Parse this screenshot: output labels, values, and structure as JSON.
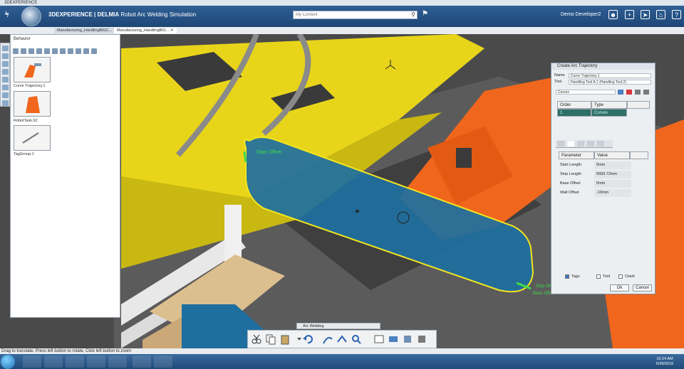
{
  "window": {
    "title": "3DEXPERIENCE"
  },
  "header": {
    "brand": "3DEXPERIENCE | DELMIA",
    "app_name": "Robot Arc Welding Simulation",
    "search_placeholder": "My Content",
    "user": "Demo Developer2"
  },
  "tabs": [
    {
      "label": "Manufacturing_HandlingBiGC..."
    },
    {
      "label": "Manufacturing_HandlingBiG..."
    }
  ],
  "behavior_panel": {
    "title": "Behavior",
    "items": [
      {
        "label": "Curve Trajectory.1"
      },
      {
        "label": "RobotTask.92"
      },
      {
        "label": "TagGroup.1"
      }
    ]
  },
  "dialog": {
    "title": "Create Arc Trajectory",
    "name_label": "Name",
    "name_value": "Curve Trajectory.1",
    "tool_label": "Tool",
    "tool_value": "Handling Tool A.1 (Handling Tool.2)",
    "mode_select": "Curves",
    "grid_headers": [
      "Order",
      "Type"
    ],
    "grid_row": [
      "1",
      "Curves"
    ],
    "param_headers": [
      "Parameter",
      "Value"
    ],
    "params": [
      {
        "name": "Start Length",
        "value": "0mm"
      },
      {
        "name": "Stop Length",
        "value": "5683.72mm"
      },
      {
        "name": "Base Offset",
        "value": "0mm"
      },
      {
        "name": "Wall Offset",
        "value": "-10mm"
      }
    ],
    "checkboxes": [
      {
        "label": "Tags",
        "checked": true
      },
      {
        "label": "Tool",
        "checked": false
      },
      {
        "label": "Clash",
        "checked": false
      }
    ],
    "ok_label": "Ok",
    "cancel_label": "Cancel"
  },
  "viewport": {
    "curve_label": "Start Offset",
    "end_label_1": "Stop Offset",
    "end_label_2": "Base Offset"
  },
  "action_bar": {
    "label": "Arc Welding"
  },
  "status_bar": {
    "text": "Drag to translate. Press left button to rotate. Click left button to zoom"
  },
  "taskbar": {
    "time": "10:24 AM",
    "date": "6/28/2016"
  },
  "colors": {
    "header": "#2f5f95",
    "robot_orange": "#f0661c",
    "part_yellow": "#e8d51a",
    "plate_blue": "#1e6fa0"
  }
}
